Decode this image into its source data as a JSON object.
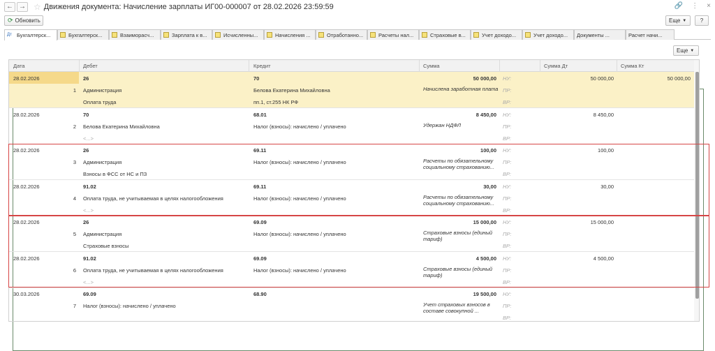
{
  "window": {
    "title": "Движения документа: Начисление зарплаты ИГ00-000007 от 28.02.2026 23:59:59"
  },
  "toolbar": {
    "refresh": "Обновить",
    "more": "Еще",
    "help": "?"
  },
  "tabs": [
    {
      "label": "Бухгалтерск...",
      "icon": "accounting-icon"
    },
    {
      "label": "Бухгалтерск...",
      "icon": "register-icon"
    },
    {
      "label": "Взаиморасч...",
      "icon": "register-icon"
    },
    {
      "label": "Зарплата к в...",
      "icon": "register-icon"
    },
    {
      "label": "Исчисленны...",
      "icon": "register-icon"
    },
    {
      "label": "Начисления ...",
      "icon": "register-icon"
    },
    {
      "label": "Отработанно...",
      "icon": "register-icon"
    },
    {
      "label": "Расчеты нал...",
      "icon": "register-icon"
    },
    {
      "label": "Страховые в...",
      "icon": "register-icon"
    },
    {
      "label": "Учет доходо...",
      "icon": "register-icon"
    },
    {
      "label": "Учет доходо...",
      "icon": "register-icon"
    },
    {
      "label": "Документы ...",
      "icon": "grid-icon"
    },
    {
      "label": "Расчет начи...",
      "icon": "grid-icon"
    }
  ],
  "table_more": "Еще",
  "columns": {
    "date": "Дата",
    "debit": "Дебет",
    "credit": "Кредит",
    "sum": "Сумма",
    "sum_dt": "Сумма Дт",
    "sum_kt": "Сумма Кт"
  },
  "rows": [
    {
      "date": "28.02.2026",
      "num": "1",
      "debit": [
        "26",
        "Администрация",
        "Оплата труда"
      ],
      "credit": [
        "70",
        "Белова Екатерина Михайловна",
        "пп.1, ст.255 НК РФ"
      ],
      "sum": "50 000,00",
      "content": "Начислена заработная плата",
      "types": [
        "НУ:",
        "ПР:",
        "ВР:"
      ],
      "dt": "50 000,00",
      "kt": "50 000,00"
    },
    {
      "date": "28.02.2026",
      "num": "2",
      "debit": [
        "70",
        "Белова Екатерина Михайловна",
        "<...>"
      ],
      "credit": [
        "68.01",
        "Налог (взносы): начислено / уплачено",
        ""
      ],
      "sum": "8 450,00",
      "content": "Удержан НДФЛ",
      "types": [
        "НУ:",
        "ПР:",
        "ВР:"
      ],
      "dt": "8 450,00",
      "kt": ""
    },
    {
      "date": "28.02.2026",
      "num": "3",
      "debit": [
        "26",
        "Администрация",
        "Взносы в ФСС от НС и ПЗ"
      ],
      "credit": [
        "69.11",
        "Налог (взносы): начислено / уплачено",
        ""
      ],
      "sum": "100,00",
      "content": "Расчеты по обязательному социальному страхованию...",
      "types": [
        "НУ:",
        "ПР:",
        "ВР:"
      ],
      "dt": "100,00",
      "kt": ""
    },
    {
      "date": "28.02.2026",
      "num": "4",
      "debit": [
        "91.02",
        "Оплата труда, не учитываемая в целях налогообложения",
        "<...>"
      ],
      "credit": [
        "69.11",
        "Налог (взносы): начислено / уплачено",
        ""
      ],
      "sum": "30,00",
      "content": "Расчеты по обязательному социальному страхованию...",
      "types": [
        "НУ:",
        "ПР:",
        "ВР:"
      ],
      "dt": "30,00",
      "kt": ""
    },
    {
      "date": "28.02.2026",
      "num": "5",
      "debit": [
        "26",
        "Администрация",
        "Страховые взносы"
      ],
      "credit": [
        "69.09",
        "Налог (взносы): начислено / уплачено",
        ""
      ],
      "sum": "15 000,00",
      "content": "Страховые взносы (единый тариф)",
      "types": [
        "НУ:",
        "ПР:",
        "ВР:"
      ],
      "dt": "15 000,00",
      "kt": ""
    },
    {
      "date": "28.02.2026",
      "num": "6",
      "debit": [
        "91.02",
        "Оплата труда, не учитываемая в целях налогообложения",
        "<...>"
      ],
      "credit": [
        "69.09",
        "Налог (взносы): начислено / уплачено",
        ""
      ],
      "sum": "4 500,00",
      "content": "Страховые взносы (единый тариф)",
      "types": [
        "НУ:",
        "ПР:",
        "ВР:"
      ],
      "dt": "4 500,00",
      "kt": ""
    },
    {
      "date": "30.03.2026",
      "num": "7",
      "debit": [
        "69.09",
        "Налог (взносы): начислено / уплачено",
        ""
      ],
      "credit": [
        "68.90",
        "",
        ""
      ],
      "sum": "19 500,00",
      "content": "Учет страховых взносов в составе совокупной ...",
      "types": [
        "НУ:",
        "ПР:",
        "ВР:"
      ],
      "dt": "",
      "kt": ""
    }
  ]
}
